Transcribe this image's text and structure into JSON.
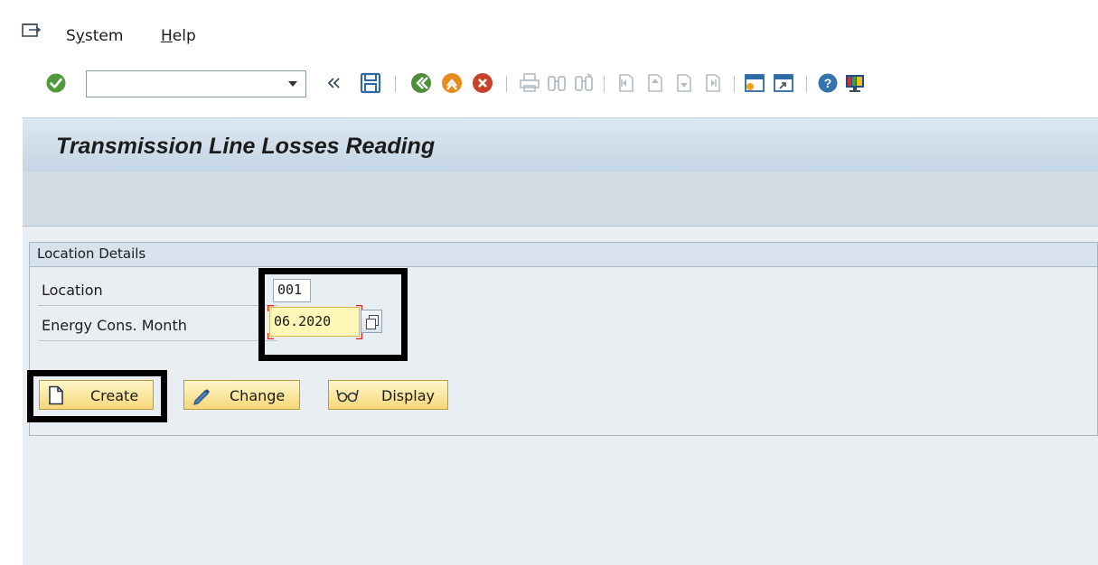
{
  "menu": {
    "items": [
      {
        "label_pre": "S",
        "label_u": "y",
        "label_post": "stem"
      },
      {
        "label_pre": "",
        "label_u": "H",
        "label_post": "elp"
      }
    ]
  },
  "toolbar": {
    "command_field_value": "",
    "icons": [
      "enter-check-icon",
      "command-dropdown-icon",
      "collapse-icon",
      "save-icon",
      "back-icon",
      "exit-icon",
      "cancel-icon",
      "print-icon",
      "find-icon",
      "find-next-icon",
      "first-page-icon",
      "previous-page-icon",
      "next-page-icon",
      "last-page-icon",
      "create-session-icon",
      "shortcut-icon",
      "help-icon",
      "customize-layout-icon"
    ]
  },
  "screen": {
    "title": "Transmission Line Losses Reading"
  },
  "location_group": {
    "title": "Location Details",
    "fields": [
      {
        "label": "Location",
        "value": "001"
      },
      {
        "label": "Energy Cons. Month",
        "value": "06.2020"
      }
    ]
  },
  "buttons": {
    "create": "Create",
    "change": "Change",
    "display": "Display"
  },
  "colors": {
    "accent_button": "#f6d87a",
    "title_bar": "#c4d5e4",
    "screen_bg": "#e9eef3",
    "required_field": "#fff7b8",
    "highlight_frame": "#000000"
  }
}
